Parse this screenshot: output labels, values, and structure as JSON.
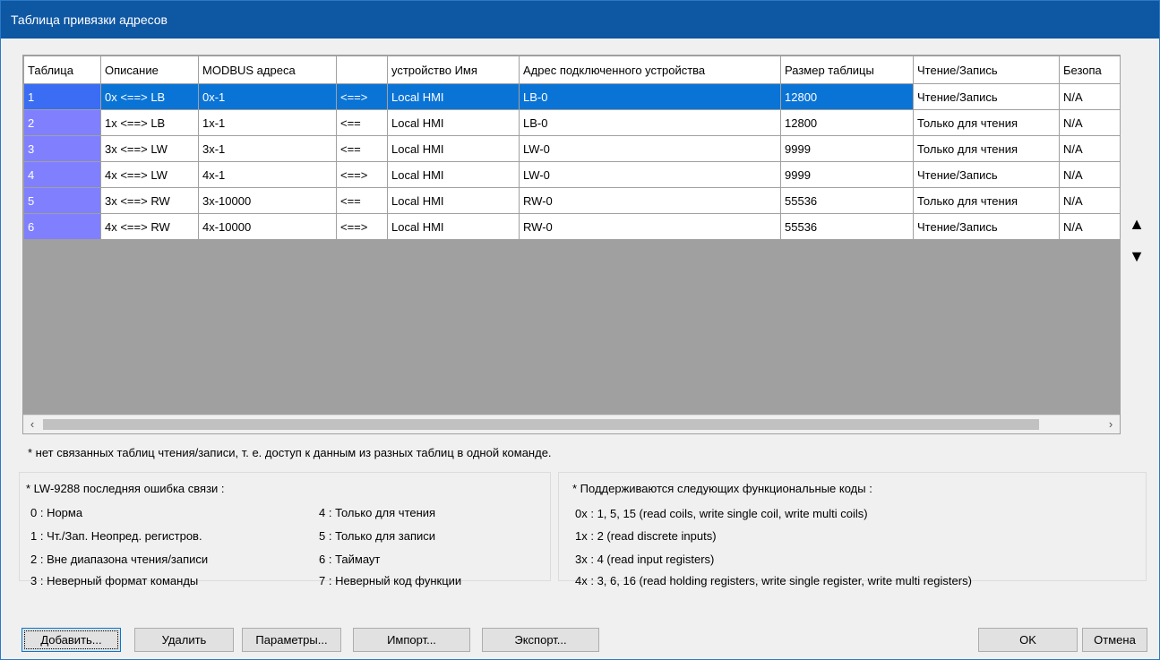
{
  "window": {
    "title": "Таблица привязки адресов"
  },
  "grid": {
    "columns": [
      "Таблица",
      "Описание",
      "MODBUS адреса",
      "",
      "устройство Имя",
      "Адрес подключенного устройства",
      "Размер таблицы",
      "Чтение/Запись",
      "Безопа"
    ],
    "rows": [
      [
        "1",
        "0x <==> LB",
        "0x-1",
        "<==>",
        "Local HMI",
        "LB-0",
        "12800",
        "Чтение/Запись",
        "N/A"
      ],
      [
        "2",
        "1x <==> LB",
        "1x-1",
        "<==",
        "Local HMI",
        "LB-0",
        "12800",
        "Только для чтения",
        "N/A"
      ],
      [
        "3",
        "3x <==> LW",
        "3x-1",
        "<==",
        "Local HMI",
        "LW-0",
        "9999",
        "Только для чтения",
        "N/A"
      ],
      [
        "4",
        "4x <==> LW",
        "4x-1",
        "<==>",
        "Local HMI",
        "LW-0",
        "9999",
        "Чтение/Запись",
        "N/A"
      ],
      [
        "5",
        "3x <==> RW",
        "3x-10000",
        "<==",
        "Local HMI",
        "RW-0",
        "55536",
        "Только для чтения",
        "N/A"
      ],
      [
        "6",
        "4x <==> RW",
        "4x-10000",
        "<==>",
        "Local HMI",
        "RW-0",
        "55536",
        "Чтение/Запись",
        "N/A"
      ]
    ],
    "selected_row": 0,
    "scroll_left_glyph": "‹",
    "scroll_right_glyph": "›"
  },
  "side": {
    "up_glyph": "▲",
    "down_glyph": "▼"
  },
  "note": "* нет связанных таблиц чтения/записи, т. е. доступ к данным из разных таблиц в одной команде.",
  "errors": {
    "title": "* LW-9288 последняя ошибка связи :",
    "items": [
      "0 : Норма",
      "1 : Чт./Зап. Неопред. регистров.",
      "2 : Вне диапазона чтения/записи",
      "3 : Неверный формат команды",
      "4 : Только для чтения",
      "5 : Только для записи",
      "6 : Таймаут",
      "7 : Неверный код функции"
    ]
  },
  "function_codes": {
    "title": "* Поддерживаются следующих функциональные коды :",
    "items": [
      "0x : 1, 5, 15 (read coils, write single coil, write multi coils)",
      "1x : 2 (read discrete inputs)",
      "3x : 4 (read input registers)",
      "4x : 3, 6, 16 (read holding registers, write single register, write multi registers)"
    ]
  },
  "buttons": {
    "add": "Добавить...",
    "delete": "Удалить",
    "params": "Параметры...",
    "import": "Импорт...",
    "export": "Экспорт...",
    "ok": "OK",
    "cancel": "Отмена"
  }
}
